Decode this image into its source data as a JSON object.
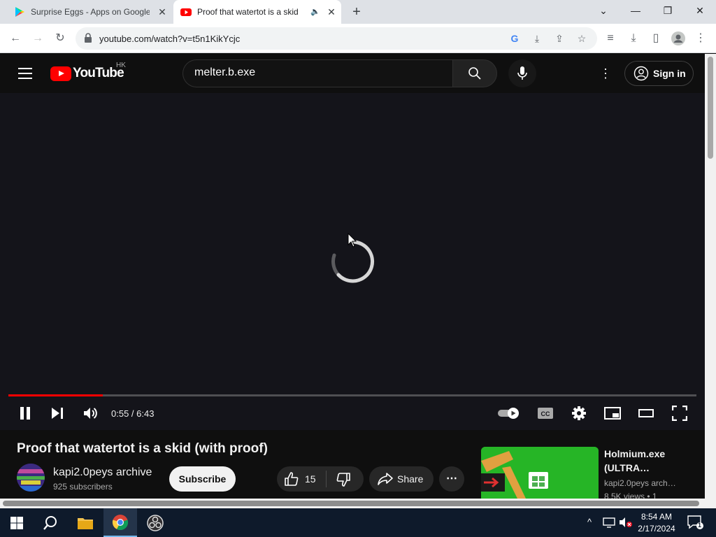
{
  "browser": {
    "tabs": [
      {
        "title": "Surprise Eggs - Apps on Google Play"
      },
      {
        "title": "Proof that watertot is a skid (with proof) - YouTube"
      }
    ],
    "url": "youtube.com/watch?v=t5n1KikYcjc"
  },
  "youtube": {
    "region": "HK",
    "logo_text": "YouTube",
    "search_value": "melter.b.exe",
    "sign_in": "Sign in",
    "player": {
      "time": "0:55 / 6:43",
      "progress_fraction": 0.137,
      "state": "loading"
    },
    "video": {
      "title": "Proof that watertot is a skid (with proof)",
      "channel": "kapi2.0peys archive",
      "subscribers": "925 subscribers",
      "subscribe": "Subscribe",
      "likes": "15",
      "share": "Share"
    },
    "related": {
      "title": "Holmium.exe (ULTRA…",
      "channel": "kapi2.0peys arch…",
      "views": "8.5K views • 1"
    }
  },
  "taskbar": {
    "time": "8:54 AM",
    "date": "2/17/2024",
    "notifications": "1"
  },
  "colors": {
    "yt_red": "#ff0000",
    "yt_bg": "#0f0f0f",
    "chrome_tabstrip": "#dee1e6",
    "taskbar": "#0e1a2b"
  }
}
